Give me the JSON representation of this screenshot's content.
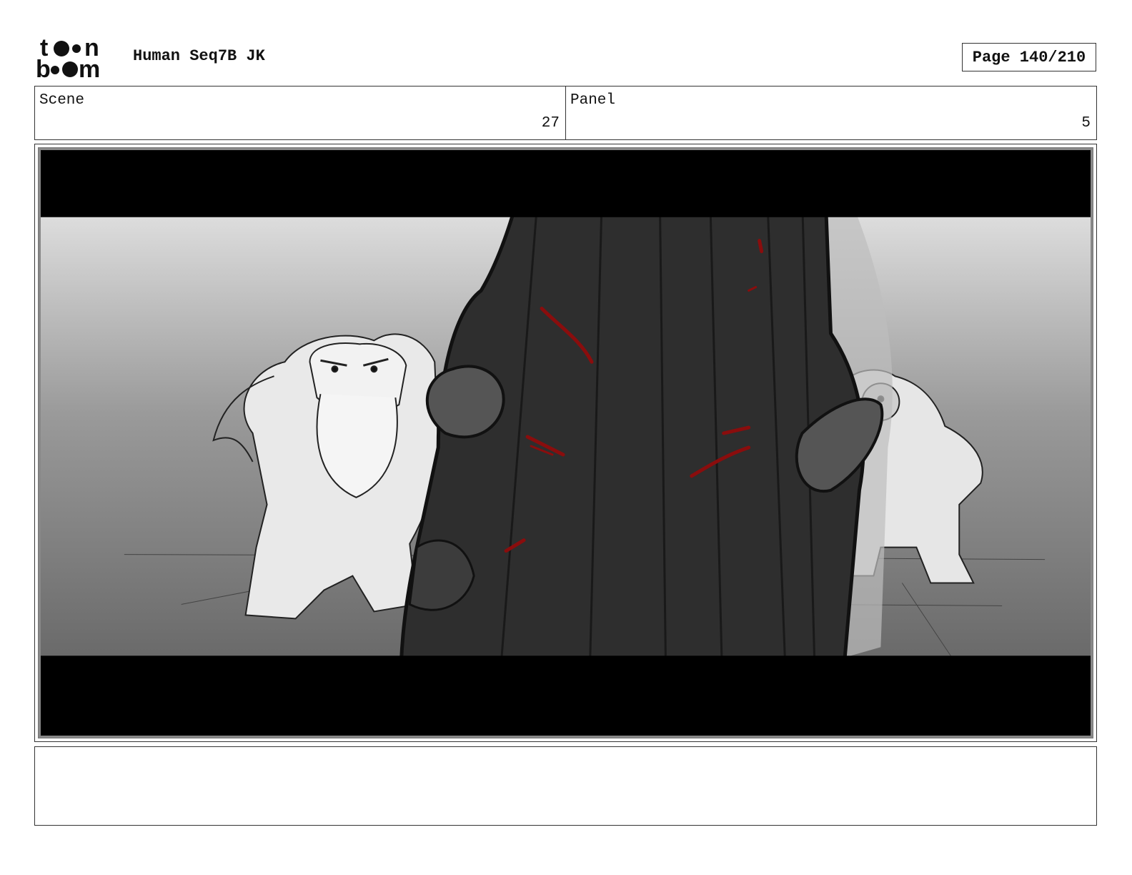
{
  "header": {
    "logo": {
      "name": "toonboom-logo",
      "line1": "toon",
      "line2": "boom"
    },
    "project_title": "Human Seq7B JK",
    "page_label": "Page 140/210"
  },
  "info": {
    "scene_label": "Scene",
    "scene_value": "27",
    "panel_label": "Panel",
    "panel_value": "5"
  },
  "frame": {
    "image_description_icon": "storyboard-sketch",
    "colors": {
      "letterbox": "#000000",
      "blood": "#8a0d0d",
      "sword": "#2e2e2e"
    }
  },
  "notes": {
    "text": ""
  }
}
